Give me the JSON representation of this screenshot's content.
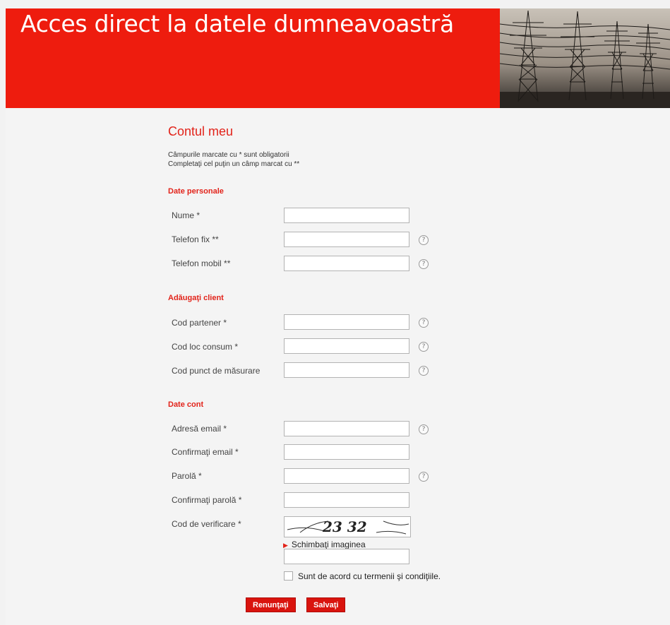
{
  "header": {
    "title": "Acces direct la datele dumneavoastră",
    "background_color": "#ee1c0e",
    "image_icon": "power-lines-photo"
  },
  "page": {
    "title": "Contul meu",
    "note_required": "Câmpurile marcate cu * sunt obligatorii",
    "note_at_least_one": "Completaţi cel puţin un câmp marcat cu **"
  },
  "sections": {
    "personal": {
      "title": "Date personale",
      "fields": {
        "name": {
          "label": "Nume *",
          "value": ""
        },
        "phone_fixed": {
          "label": "Telefon fix **",
          "value": ""
        },
        "phone_mobile": {
          "label": "Telefon mobil **",
          "value": ""
        }
      }
    },
    "client": {
      "title": "Adăugaţi client",
      "fields": {
        "partner_code": {
          "label": "Cod partener *",
          "value": ""
        },
        "consumption_place_code": {
          "label": "Cod loc consum *",
          "value": ""
        },
        "metering_point_code": {
          "label": "Cod punct de măsurare",
          "value": ""
        }
      }
    },
    "account": {
      "title": "Date cont",
      "fields": {
        "email": {
          "label": "Adresă email *",
          "value": ""
        },
        "email_confirm": {
          "label": "Confirmaţi email *",
          "value": ""
        },
        "password": {
          "label": "Parolă *",
          "value": ""
        },
        "password_confirm": {
          "label": "Confirmaţi parolă *",
          "value": ""
        },
        "captcha": {
          "label": "Cod de verificare *",
          "value": ""
        }
      },
      "captcha_text": "23 32",
      "change_image": "Schimbaţi imaginea",
      "terms": "Sunt de acord cu termenii şi condiţiile.",
      "terms_checked": false
    }
  },
  "help_icon": "?",
  "buttons": {
    "cancel": "Renunţaţi",
    "save": "Salvaţi"
  },
  "colors": {
    "accent": "#e2231a",
    "button": "#d9140e"
  }
}
